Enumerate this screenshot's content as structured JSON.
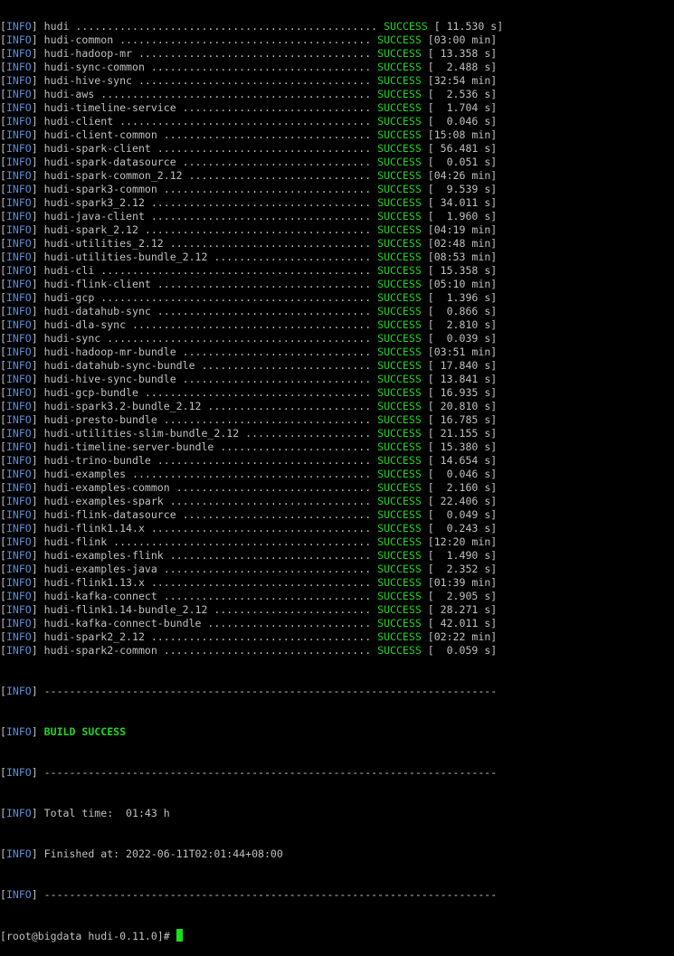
{
  "terminal": {
    "info_tag": "INFO",
    "status_word": "SUCCESS",
    "separator": "------------------------------------------------------------------------",
    "modules": [
      {
        "dots": "hudi ................................................",
        "time": "[ 11.530 s]"
      },
      {
        "dots": "hudi-common ........................................",
        "time": "[03:00 min]"
      },
      {
        "dots": "hudi-hadoop-mr .....................................",
        "time": "[ 13.358 s]"
      },
      {
        "dots": "hudi-sync-common ...................................",
        "time": "[  2.488 s]"
      },
      {
        "dots": "hudi-hive-sync .....................................",
        "time": "[32:54 min]"
      },
      {
        "dots": "hudi-aws ...........................................",
        "time": "[  2.536 s]"
      },
      {
        "dots": "hudi-timeline-service ..............................",
        "time": "[  1.704 s]"
      },
      {
        "dots": "hudi-client ........................................",
        "time": "[  0.046 s]"
      },
      {
        "dots": "hudi-client-common .................................",
        "time": "[15:08 min]"
      },
      {
        "dots": "hudi-spark-client ..................................",
        "time": "[ 56.481 s]"
      },
      {
        "dots": "hudi-spark-datasource ..............................",
        "time": "[  0.051 s]"
      },
      {
        "dots": "hudi-spark-common_2.12 .............................",
        "time": "[04:26 min]"
      },
      {
        "dots": "hudi-spark3-common .................................",
        "time": "[  9.539 s]"
      },
      {
        "dots": "hudi-spark3_2.12 ...................................",
        "time": "[ 34.011 s]"
      },
      {
        "dots": "hudi-java-client ...................................",
        "time": "[  1.960 s]"
      },
      {
        "dots": "hudi-spark_2.12 ....................................",
        "time": "[04:19 min]"
      },
      {
        "dots": "hudi-utilities_2.12 ................................",
        "time": "[02:48 min]"
      },
      {
        "dots": "hudi-utilities-bundle_2.12 .........................",
        "time": "[08:53 min]"
      },
      {
        "dots": "hudi-cli ...........................................",
        "time": "[ 15.358 s]"
      },
      {
        "dots": "hudi-flink-client ..................................",
        "time": "[05:10 min]"
      },
      {
        "dots": "hudi-gcp ...........................................",
        "time": "[  1.396 s]"
      },
      {
        "dots": "hudi-datahub-sync ..................................",
        "time": "[  0.866 s]"
      },
      {
        "dots": "hudi-dla-sync ......................................",
        "time": "[  2.810 s]"
      },
      {
        "dots": "hudi-sync ..........................................",
        "time": "[  0.039 s]"
      },
      {
        "dots": "hudi-hadoop-mr-bundle ..............................",
        "time": "[03:51 min]"
      },
      {
        "dots": "hudi-datahub-sync-bundle ...........................",
        "time": "[ 17.840 s]"
      },
      {
        "dots": "hudi-hive-sync-bundle ..............................",
        "time": "[ 13.841 s]"
      },
      {
        "dots": "hudi-gcp-bundle ....................................",
        "time": "[ 16.935 s]"
      },
      {
        "dots": "hudi-spark3.2-bundle_2.12 ..........................",
        "time": "[ 20.810 s]"
      },
      {
        "dots": "hudi-presto-bundle .................................",
        "time": "[ 16.785 s]"
      },
      {
        "dots": "hudi-utilities-slim-bundle_2.12 ....................",
        "time": "[ 21.155 s]"
      },
      {
        "dots": "hudi-timeline-server-bundle ........................",
        "time": "[ 15.380 s]"
      },
      {
        "dots": "hudi-trino-bundle ..................................",
        "time": "[ 14.654 s]"
      },
      {
        "dots": "hudi-examples ......................................",
        "time": "[  0.046 s]"
      },
      {
        "dots": "hudi-examples-common ...............................",
        "time": "[  2.160 s]"
      },
      {
        "dots": "hudi-examples-spark ................................",
        "time": "[ 22.406 s]"
      },
      {
        "dots": "hudi-flink-datasource ..............................",
        "time": "[  0.049 s]"
      },
      {
        "dots": "hudi-flink1.14.x ...................................",
        "time": "[  0.243 s]"
      },
      {
        "dots": "hudi-flink .........................................",
        "time": "[12:20 min]"
      },
      {
        "dots": "hudi-examples-flink ................................",
        "time": "[  1.490 s]"
      },
      {
        "dots": "hudi-examples-java .................................",
        "time": "[  2.352 s]"
      },
      {
        "dots": "hudi-flink1.13.x ...................................",
        "time": "[01:39 min]"
      },
      {
        "dots": "hudi-kafka-connect .................................",
        "time": "[  2.905 s]"
      },
      {
        "dots": "hudi-flink1.14-bundle_2.12 .........................",
        "time": "[ 28.271 s]"
      },
      {
        "dots": "hudi-kafka-connect-bundle ..........................",
        "time": "[ 42.011 s]"
      },
      {
        "dots": "hudi-spark2_2.12 ...................................",
        "time": "[02:22 min]"
      },
      {
        "dots": "hudi-spark2-common .................................",
        "time": "[  0.059 s]"
      }
    ],
    "build_result": "BUILD SUCCESS",
    "total_time": "Total time:  01:43 h",
    "finished_at": "Finished at: 2022-06-11T02:01:44+08:00",
    "prompt": "[root@bigdata hudi-0.11.0]# "
  },
  "colors": {
    "background": "#000000",
    "text": "#c0c0c0",
    "info_tag": "#5b8fd6",
    "success": "#1fd61f",
    "cursor": "#18e018"
  }
}
